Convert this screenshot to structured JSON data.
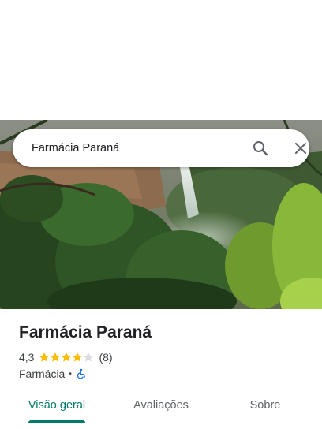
{
  "search": {
    "query": "Farmácia Paraná"
  },
  "place": {
    "name": "Farmácia Paraná",
    "rating": "4,3",
    "rating_stars": 4.3,
    "review_count": "(8)",
    "category": "Farmácia",
    "separator": "•",
    "accessibility": "wheelchair-accessible-icon"
  },
  "tabs": [
    {
      "label": "Visão geral",
      "active": true
    },
    {
      "label": "Avaliações",
      "active": false
    },
    {
      "label": "Sobre",
      "active": false
    }
  ],
  "colors": {
    "accent": "#00796b",
    "star": "#fbbc04",
    "accessibility_icon": "#1a73e8"
  }
}
